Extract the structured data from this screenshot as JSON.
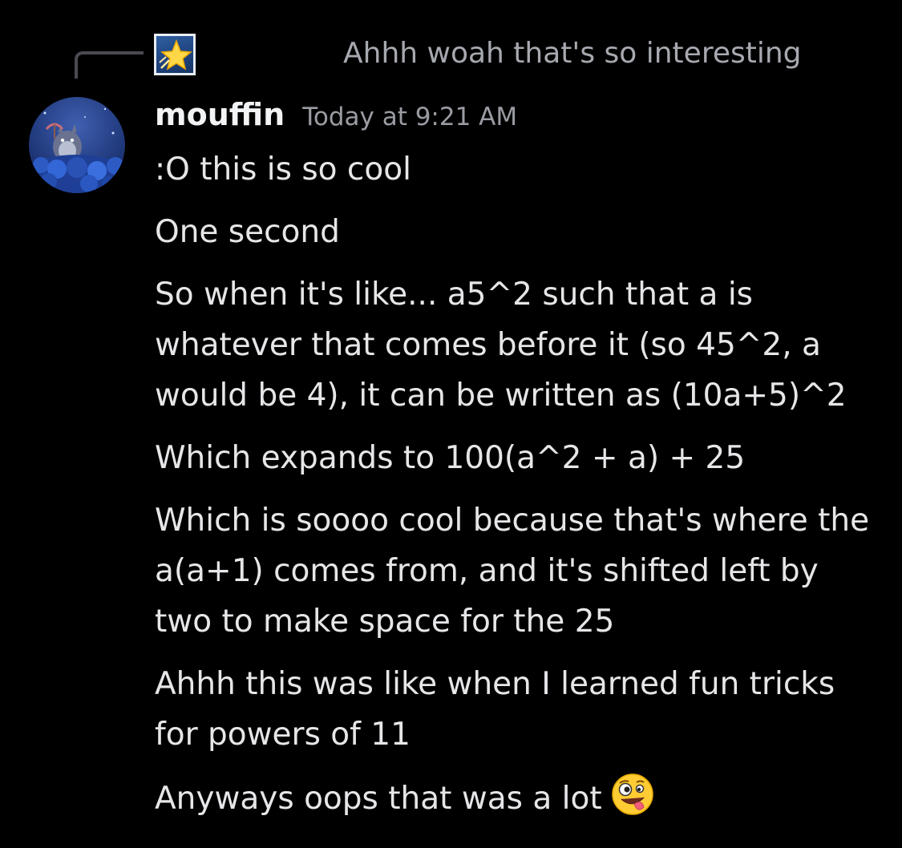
{
  "reply": {
    "preview_text": "Ahhh woah that's so interesting",
    "avatar_icon": "star-icon"
  },
  "author": {
    "username": "mouffin",
    "timestamp": "Today at 9:21 AM",
    "avatar_icon": "totoro-avatar-icon"
  },
  "messages": [
    {
      "text": ":O this is so cool"
    },
    {
      "text": "One second"
    },
    {
      "text": "So when it's like... a5^2 such that a is whatever that comes before it (so 45^2, a would be 4), it can be written as (10a+5)^2"
    },
    {
      "text": "Which expands to 100(a^2 + a) + 25"
    },
    {
      "text": "Which is soooo cool because that's where the a(a+1) comes from, and it's shifted left by two to make space for the 25"
    },
    {
      "text": "Ahhh this was like when I learned fun tricks for powers of 11"
    },
    {
      "text": "Anyways oops that was a lot",
      "emoji": "zany-face-emoji"
    }
  ],
  "colors": {
    "background": "#000000",
    "username": "#f2f3f5",
    "timestamp": "#9a9ca3",
    "message_text": "#e6e6e9",
    "reply_text": "#a7a9b0",
    "reply_line": "#4a4b51"
  }
}
